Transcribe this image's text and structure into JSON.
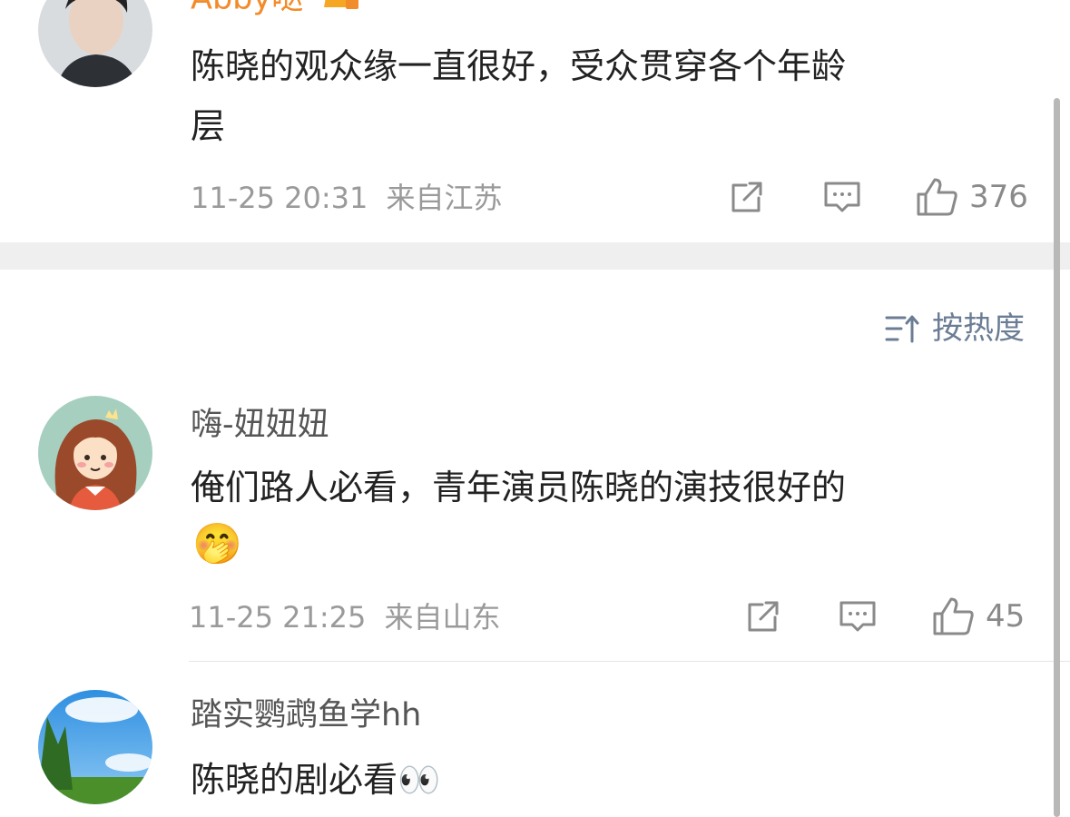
{
  "comments": [
    {
      "username": "Abby哒",
      "text_lines": [
        "陈晓的观众缘一直很好，受众贯穿各个年龄",
        "层"
      ],
      "time": "11-25 20:31",
      "location": "来自江苏",
      "likes": "376",
      "badge_icon": "crown-badge-icon"
    },
    {
      "username": "嗨-妞妞妞",
      "text_lines": [
        "俺们路人必看，青年演员陈晓的演技很好的"
      ],
      "emoji": "🤭",
      "time": "11-25 21:25",
      "location": "来自山东",
      "likes": "45"
    },
    {
      "username": "踏实鹦鹉鱼学hh",
      "text_lines": [
        "陈晓的剧必看👀"
      ]
    }
  ],
  "sort": {
    "label": "按热度",
    "icon": "sort-icon"
  },
  "icons": {
    "repost": "repost-icon",
    "comment": "comment-icon",
    "like": "thumbs-up-icon"
  },
  "colors": {
    "username_highlight": "#f28b2a",
    "sort_label": "#6b7d95",
    "meta_gray": "#9a9a9a"
  }
}
